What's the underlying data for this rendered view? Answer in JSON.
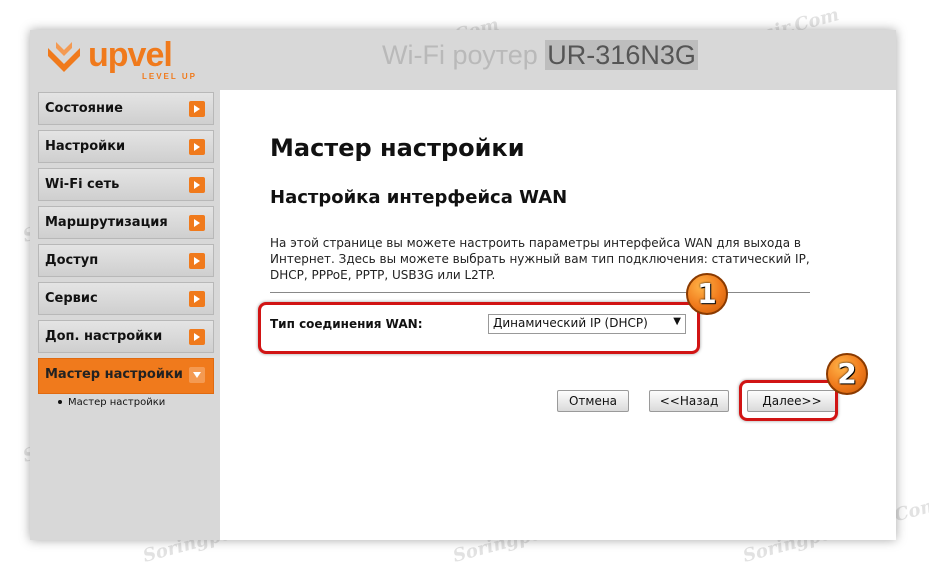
{
  "header": {
    "logo_text": "upvel",
    "logo_sub": "LEVEL UP",
    "title_prefix": "Wi-Fi роутер ",
    "model": "UR-316N3G"
  },
  "sidebar": {
    "items": [
      {
        "label": "Состояние"
      },
      {
        "label": "Настройки"
      },
      {
        "label": "Wi-Fi сеть"
      },
      {
        "label": "Маршрутизация"
      },
      {
        "label": "Доступ"
      },
      {
        "label": "Сервис"
      },
      {
        "label": "Доп. настройки"
      },
      {
        "label": "Мастер настройки",
        "active": true
      }
    ],
    "subitems": [
      {
        "label": "Мастер настройки"
      }
    ]
  },
  "main": {
    "page_title": "Мастер настройки",
    "section_title": "Настройка интерфейса WAN",
    "description": "На этой странице вы можете настроить параметры интерфейса WAN для выхода в Интернет. Здесь вы можете выбрать нужный вам тип подключения: статический IP, DHCP, PPPoE, PPTP, USB3G или L2TP.",
    "wan_label": "Тип соединения WAN:",
    "wan_value": "Динамический IP (DHCP)",
    "buttons": {
      "cancel": "Отмена",
      "back": "<<Назад",
      "next": "Далее>>"
    }
  },
  "annotations": {
    "badge1": "1",
    "badge2": "2"
  },
  "watermark": "Soringpcrepair.Com",
  "colors": {
    "accent": "#f07a1c",
    "highlight": "#d11414",
    "frame": "#d8d8d8"
  }
}
